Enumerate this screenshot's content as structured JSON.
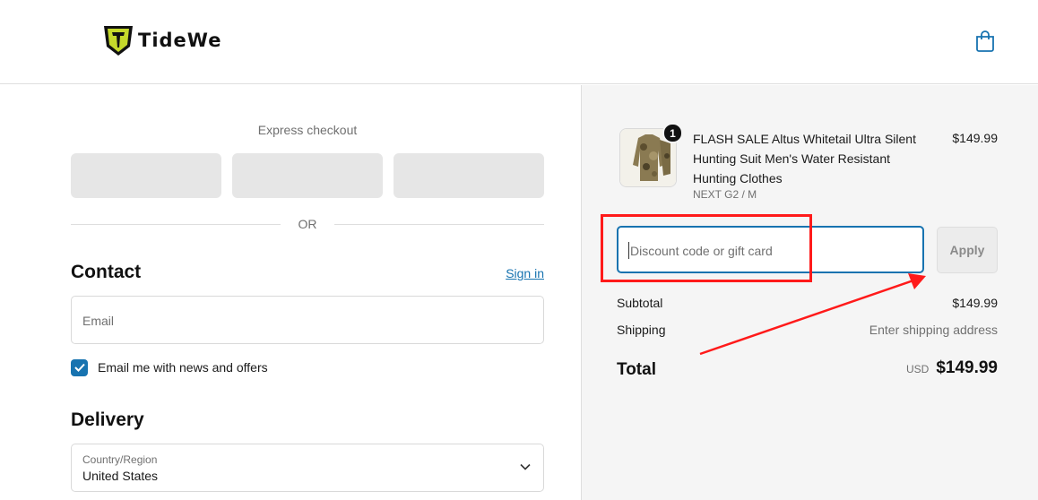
{
  "header": {
    "brand_name": "TideWe"
  },
  "express_checkout": {
    "title": "Express checkout",
    "divider_label": "OR"
  },
  "contact": {
    "title": "Contact",
    "sign_in_label": "Sign in",
    "email_placeholder": "Email",
    "news_checkbox_label": "Email me with news and offers",
    "news_checkbox_checked": true
  },
  "delivery": {
    "title": "Delivery",
    "country_label": "Country/Region",
    "country_value": "United States"
  },
  "order": {
    "item": {
      "quantity": "1",
      "name": "FLASH SALE Altus Whitetail Ultra Silent Hunting Suit Men's Water Resistant Hunting Clothes",
      "variant": "NEXT G2 / M",
      "price": "$149.99"
    },
    "discount_placeholder": "Discount code or gift card",
    "apply_label": "Apply",
    "subtotal_label": "Subtotal",
    "subtotal_value": "$149.99",
    "shipping_label": "Shipping",
    "shipping_value": "Enter shipping address",
    "total_label": "Total",
    "total_currency": "USD",
    "total_value": "$149.99"
  },
  "colors": {
    "accent": "#1773b0",
    "annotation": "#ff1a1a",
    "logo_yellow": "#c5d92b"
  }
}
